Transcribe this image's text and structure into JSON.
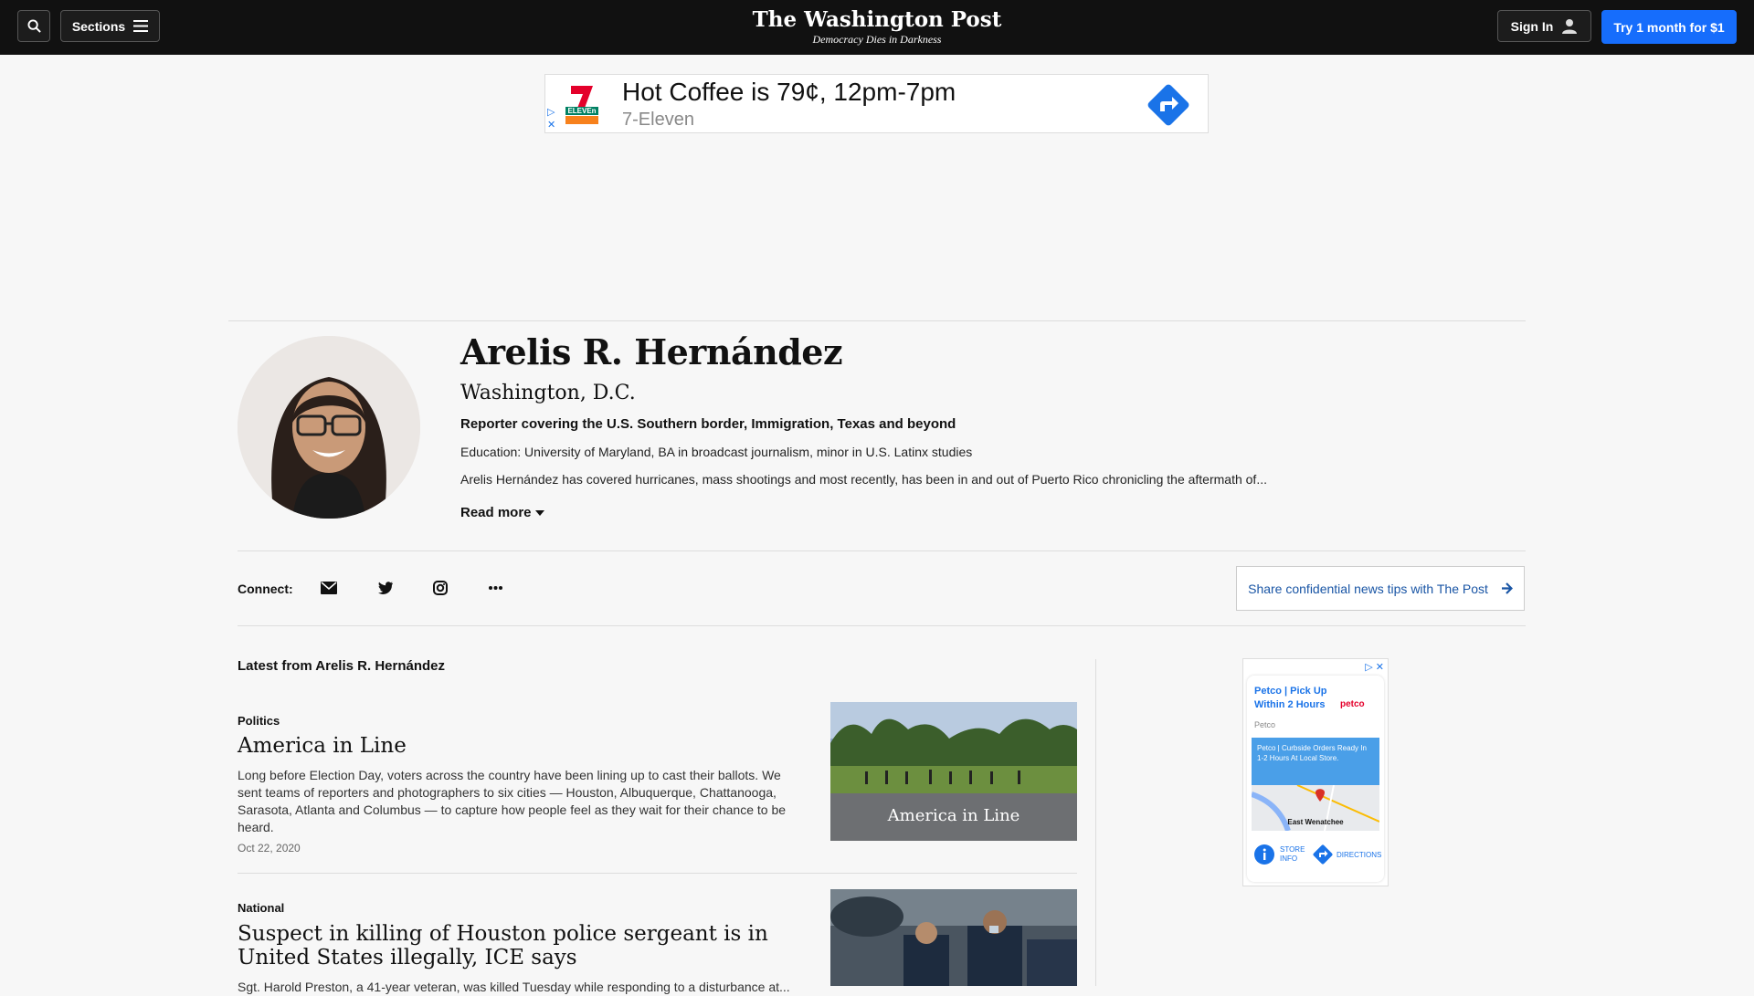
{
  "header": {
    "sections_label": "Sections",
    "logo_title": "The Washington Post",
    "logo_tagline": "Democracy Dies in Darkness",
    "signin_label": "Sign In",
    "subscribe_label": "Try 1 month for $1"
  },
  "top_ad": {
    "headline": "Hot Coffee is 79¢, 12pm-7pm",
    "advertiser": "7-Eleven",
    "brand_mark": "ELEVEn"
  },
  "author": {
    "name": "Arelis R. Hernández",
    "location": "Washington, D.C.",
    "role": "Reporter covering the U.S. Southern border, Immigration, Texas and beyond",
    "education": "Education: University of Maryland, BA in broadcast journalism, minor in U.S. Latinx studies",
    "bio": "Arelis Hernández has covered hurricanes, mass shootings and most recently, has been in and out of Puerto Rico chronicling the aftermath of...",
    "read_more": "Read more"
  },
  "connect": {
    "label": "Connect:",
    "tips_label": "Share confidential news tips with The Post"
  },
  "latest": {
    "heading": "Latest from Arelis R. Hernández",
    "stories": [
      {
        "kicker": "Politics",
        "title": "America in Line",
        "blurb": "Long before Election Day, voters across the country have been lining up to cast their ballots. We sent teams of reporters and photographers to six cities — Houston, Albuquerque, Chattanooga, Sarasota, Atlanta and Columbus — to capture how people feel as they wait for their chance to be heard.",
        "date": "Oct 22, 2020",
        "image_caption": "America in Line"
      },
      {
        "kicker": "National",
        "title": "Suspect in killing of Houston police sergeant is in United States illegally, ICE says",
        "blurb": "Sgt. Harold Preston, a 41-year veteran, was killed Tuesday while responding to a disturbance at..."
      }
    ]
  },
  "side_ad": {
    "title": "Petco | Pick Up Within 2 Hours",
    "brand": "petco",
    "advertiser": "Petco",
    "promo": "Petco | Curbside Orders Ready In 1-2 Hours At Local Store.",
    "map_label": "East Wenatchee",
    "store_info": "STORE INFO",
    "directions": "DIRECTIONS"
  }
}
